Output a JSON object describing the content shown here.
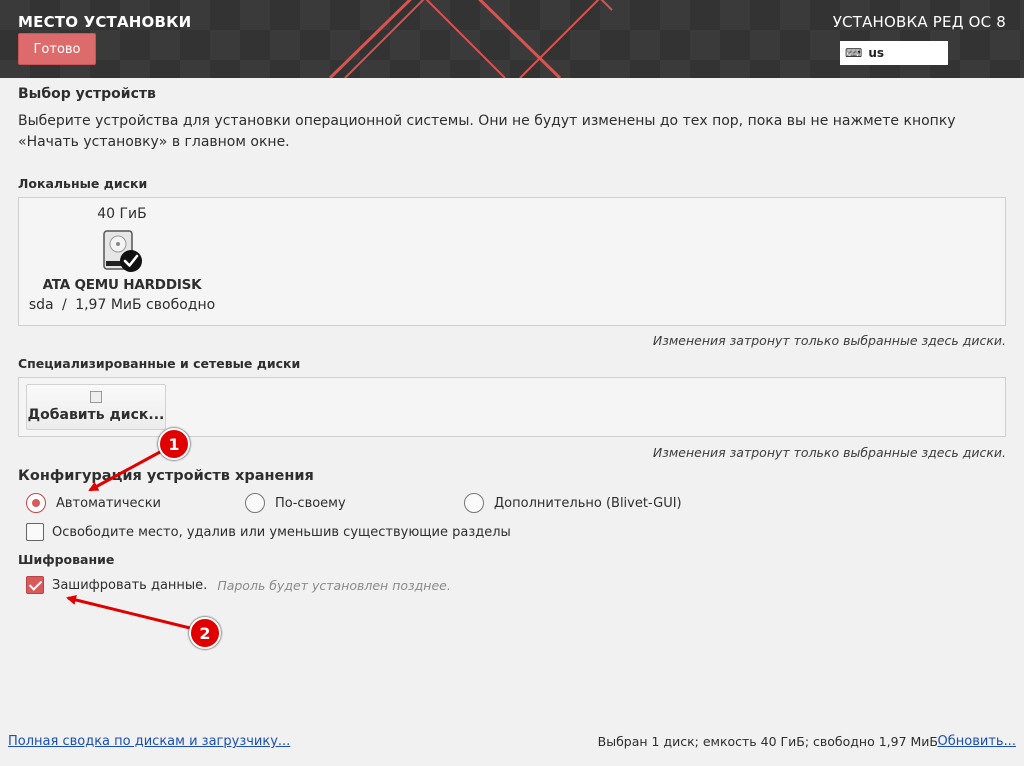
{
  "header": {
    "title": "МЕСТО УСТАНОВКИ",
    "done_label": "Готово",
    "product": "УСТАНОВКА РЕД ОС 8",
    "keyboard_layout": "us"
  },
  "device_selection": {
    "title": "Выбор устройств",
    "description": "Выберите устройства для установки операционной системы. Они не будут изменены до тех пор, пока вы не нажмете кнопку «Начать установку» в главном окне."
  },
  "local_disks": {
    "label": "Локальные диски",
    "disks": [
      {
        "size": "40 ГиБ",
        "name": "ATA QEMU HARDDISK",
        "device": "sda",
        "separator": "/",
        "free": "1,97 МиБ свободно"
      }
    ],
    "hint": "Изменения затронут только выбранные здесь диски."
  },
  "network_disks": {
    "label": "Специализированные и сетевые диски",
    "add_button": "Добавить диск...",
    "hint": "Изменения затронут только выбранные здесь диски."
  },
  "storage_config": {
    "title": "Конфигурация устройств хранения",
    "options": [
      {
        "label": "Автоматически",
        "selected": true
      },
      {
        "label": "По-своему",
        "selected": false
      },
      {
        "label": "Дополнительно (Blivet-GUI)",
        "selected": false
      }
    ],
    "reclaim_label": "Освободите место, удалив или уменьшив существующие разделы",
    "reclaim_checked": false
  },
  "encryption": {
    "title": "Шифрование",
    "encrypt_label": "Зашифровать данные.",
    "encrypt_note": "Пароль будет установлен позднее.",
    "encrypt_checked": true
  },
  "annotations": {
    "badge1": "1",
    "badge2": "2",
    "color": "#e00000"
  },
  "footer": {
    "summary_link": "Полная сводка по дискам и загрузчику...",
    "status": "Выбран 1 диск; емкость 40 ГиБ; свободно 1,97 МиБ",
    "refresh_link": "Обновить..."
  },
  "colors": {
    "accent": "#d95a5a",
    "header_bg": "#3a3a3a",
    "link": "#1a4fb8"
  }
}
